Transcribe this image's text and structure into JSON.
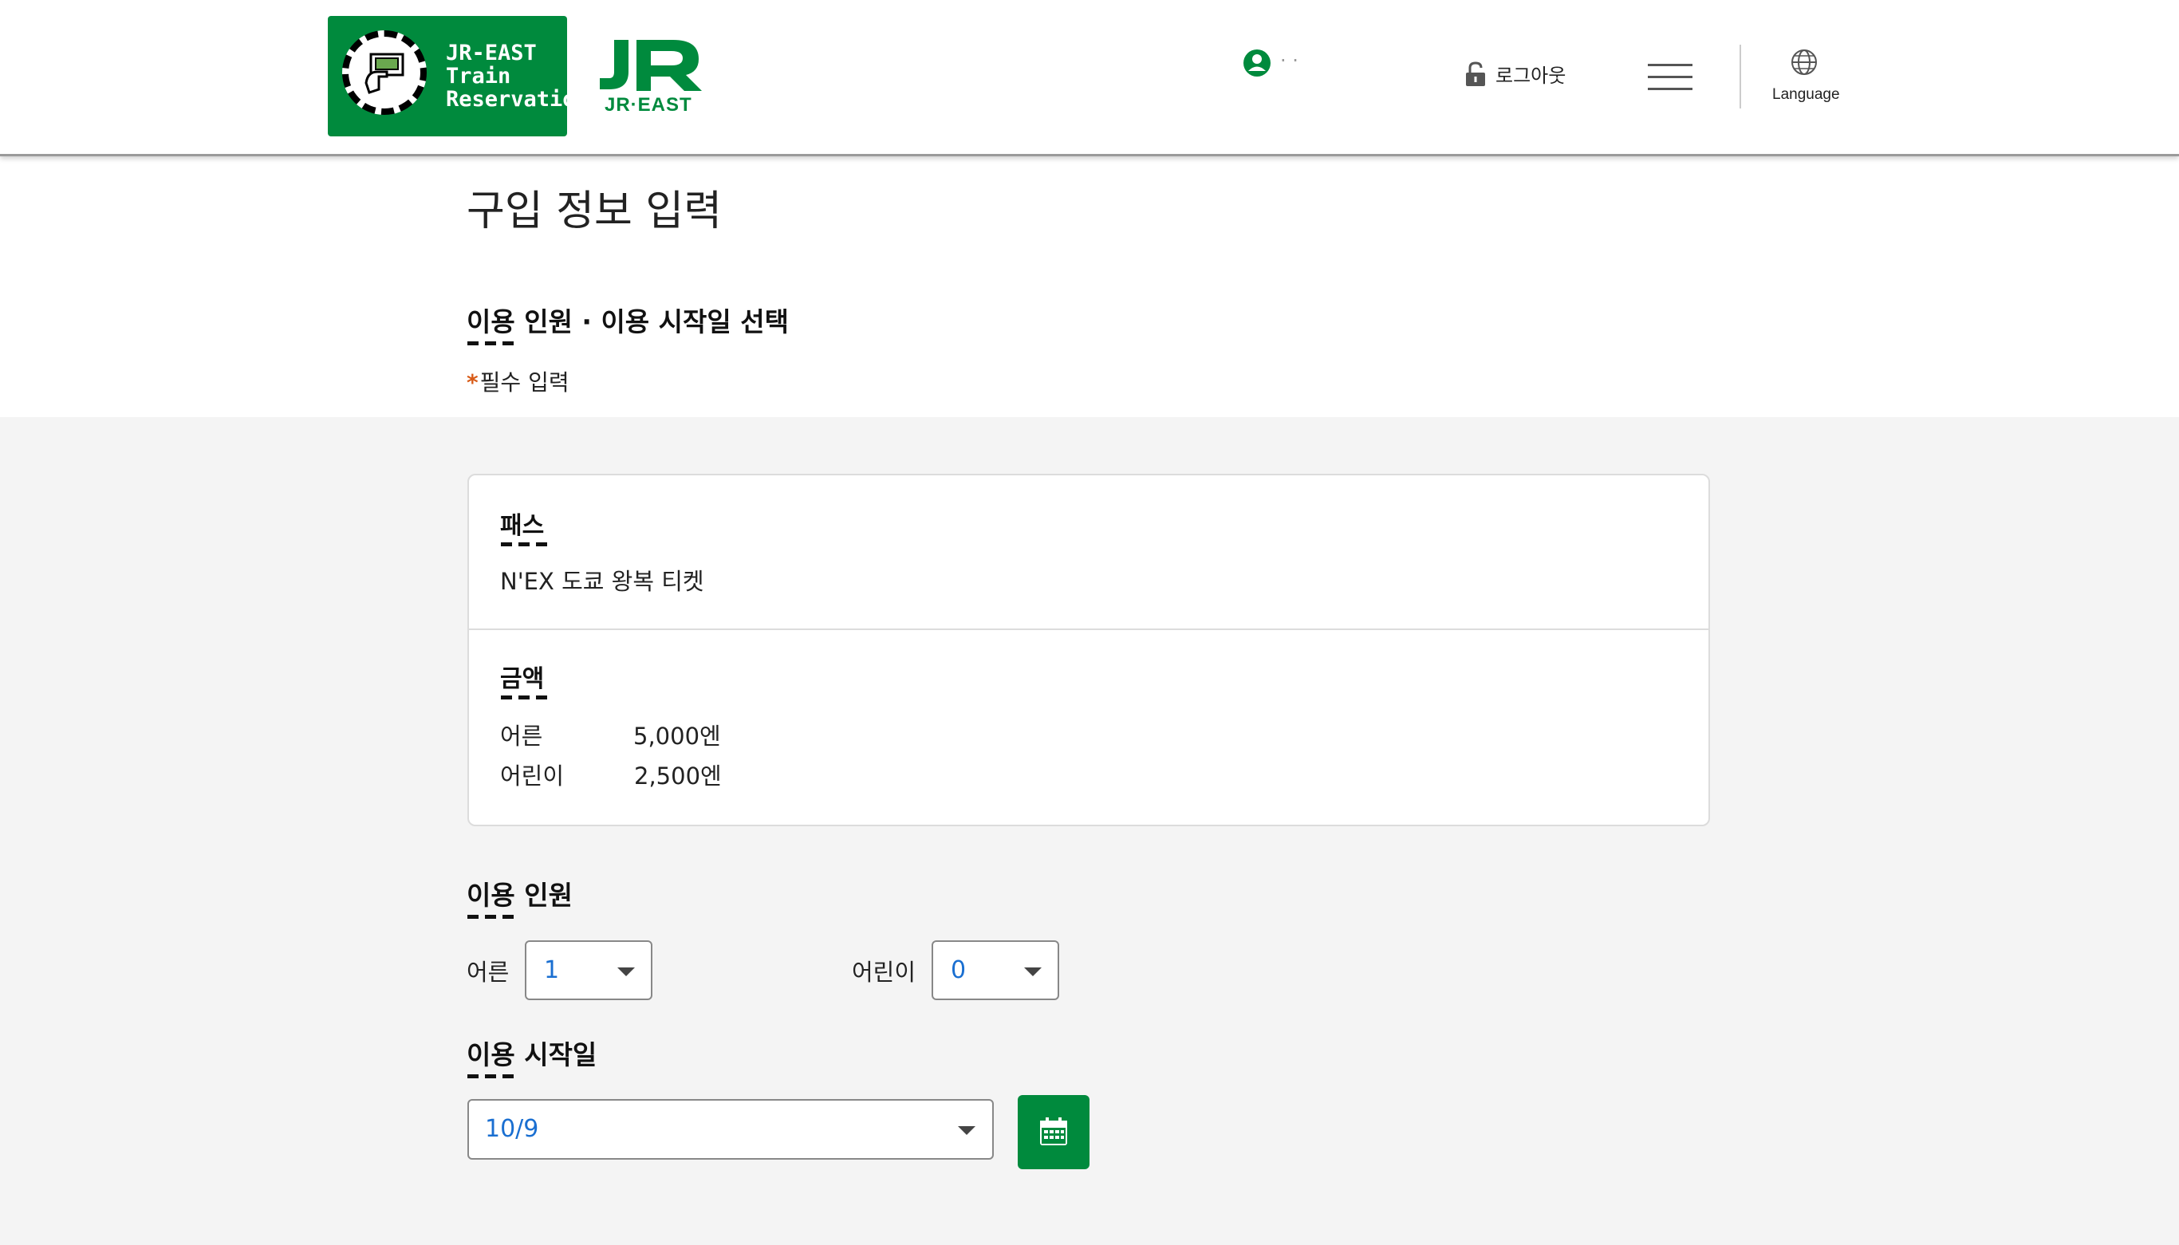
{
  "header": {
    "logo_reservation_text": "JR-EAST\nTrain\nReservation",
    "logo_jr_sub": "JR·EAST",
    "user_name": "· ·",
    "logout_label": "로그아웃",
    "language_label": "Language"
  },
  "page": {
    "title": "구입 정보 입력",
    "section_title": "이용 인원 · 이용 시작일 선택",
    "required_mark": "*",
    "required_label": "필수 입력"
  },
  "card": {
    "pass_label": "패스",
    "pass_name": "N'EX 도쿄 왕복 티켓",
    "price_label": "금액",
    "prices": [
      {
        "type": "어른",
        "amount": "5,000엔"
      },
      {
        "type": "어린이",
        "amount": "2,500엔"
      }
    ]
  },
  "people": {
    "label": "이용 인원",
    "adult_label": "어른",
    "adult_value": "1",
    "child_label": "어린이",
    "child_value": "0"
  },
  "start_date": {
    "label": "이용 시작일",
    "value": "10/9"
  },
  "colors": {
    "brand_green": "#008a3d",
    "required_orange": "#d85b17",
    "select_value_blue": "#1a6fd1"
  },
  "icons": [
    "ticket-logo-icon",
    "user-icon",
    "lock-icon",
    "menu-icon",
    "globe-icon",
    "calendar-icon",
    "chevron-down-icon"
  ]
}
